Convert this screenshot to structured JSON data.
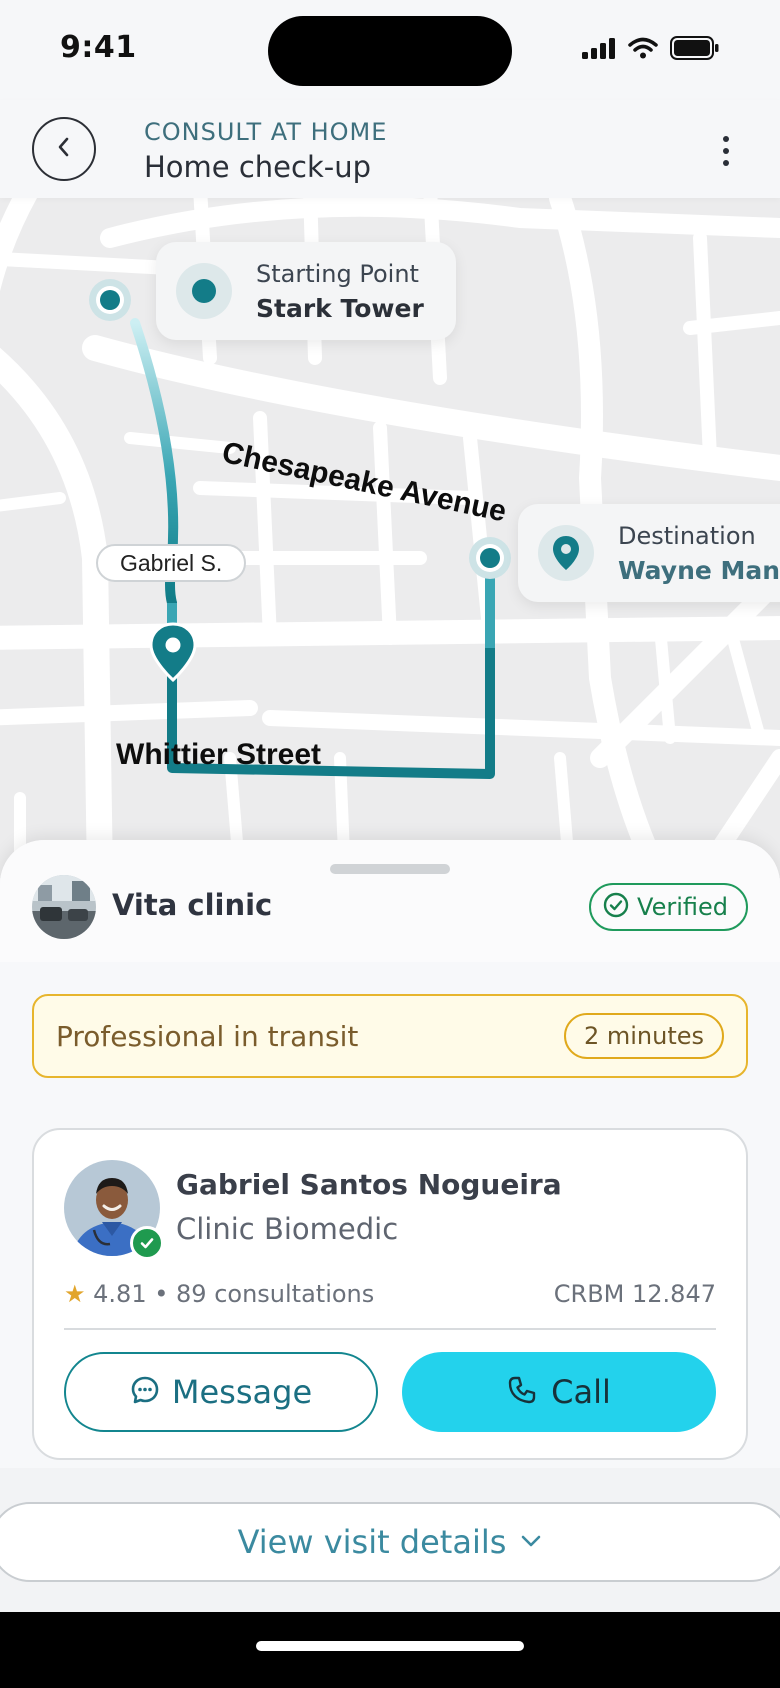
{
  "status_bar": {
    "time": "9:41"
  },
  "header": {
    "eyebrow": "CONSULT AT HOME",
    "title": "Home check-up"
  },
  "map": {
    "start": {
      "label": "Starting Point",
      "value": "Stark Tower"
    },
    "destination": {
      "label": "Destination",
      "value": "Wayne Manor"
    },
    "streets": [
      "Chesapeake Avenue",
      "Whittier Street"
    ],
    "driver_label": "Gabriel S."
  },
  "clinic": {
    "name": "Vita clinic",
    "verified_label": "Verified"
  },
  "transit": {
    "label": "Professional in transit",
    "eta": "2 minutes"
  },
  "professional": {
    "name": "Gabriel Santos Nogueira",
    "organization": "Clinic Biomedic",
    "rating": "4.81",
    "consultations": "89 consultations",
    "license": "CRBM 12.847",
    "message_label": "Message",
    "call_label": "Call"
  },
  "details_label": "View visit details",
  "colors": {
    "accent_teal": "#13868f",
    "call_cyan": "#23d2ec",
    "verified_green": "#1f9a5c",
    "warning_yellow": "#e7b52d"
  }
}
